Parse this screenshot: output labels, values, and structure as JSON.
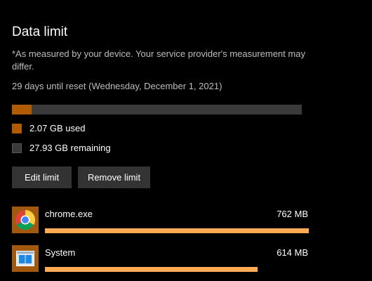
{
  "section": {
    "title": "Data limit",
    "disclaimer": "*As measured by your device. Your service provider's measurement may differ.",
    "reset_text": "29 days until reset (Wednesday, December 1, 2021)"
  },
  "usage": {
    "used_fraction": 0.069,
    "used_label": "2.07 GB used",
    "remaining_label": "27.93 GB remaining",
    "used_color": "#b15b00",
    "remaining_color": "#3a3a3a"
  },
  "buttons": {
    "edit_label": "Edit limit",
    "remove_label": "Remove limit"
  },
  "apps": [
    {
      "name": "chrome.exe",
      "size": "762 MB",
      "icon": "chrome-icon",
      "usage_fraction": 1.0
    },
    {
      "name": "System",
      "size": "614 MB",
      "icon": "system-window-icon",
      "usage_fraction": 0.806
    }
  ],
  "colors": {
    "accent": "#ffaa55",
    "icon_background": "#a3590d",
    "background": "#000000"
  }
}
